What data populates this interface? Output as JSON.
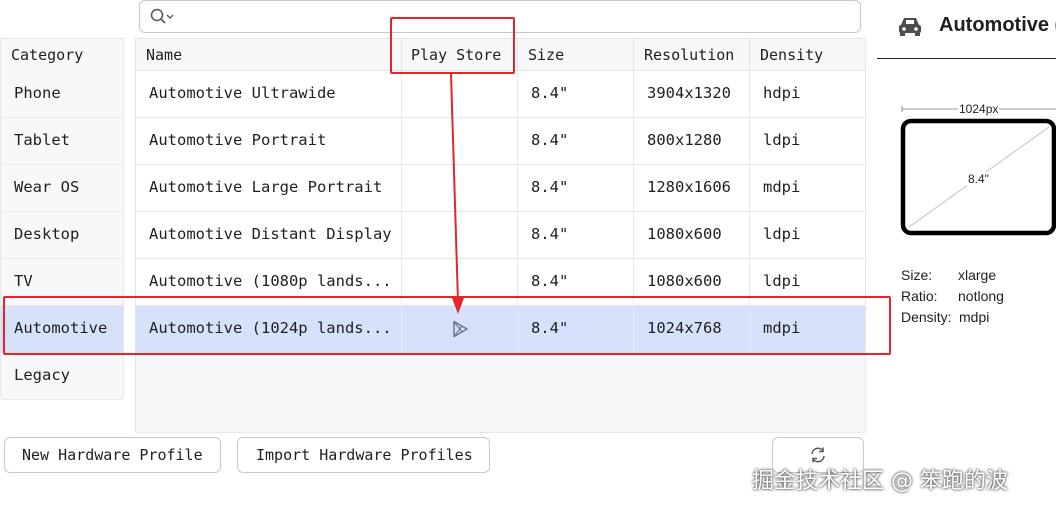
{
  "search": {
    "placeholder": ""
  },
  "category": {
    "header": "Category",
    "items": [
      "Phone",
      "Tablet",
      "Wear OS",
      "Desktop",
      "TV",
      "Automotive",
      "Legacy"
    ],
    "selected": "Automotive"
  },
  "table": {
    "headers": {
      "name": "Name",
      "play_store": "Play Store",
      "size": "Size",
      "resolution": "Resolution",
      "density": "Density"
    },
    "rows": [
      {
        "name": "Automotive Ultrawide",
        "size": "8.4\"",
        "resolution": "3904x1320",
        "density": "hdpi",
        "play_store": false
      },
      {
        "name": "Automotive Portrait",
        "size": "8.4\"",
        "resolution": "800x1280",
        "density": "ldpi",
        "play_store": false
      },
      {
        "name": "Automotive Large Portrait",
        "size": "8.4\"",
        "resolution": "1280x1606",
        "density": "mdpi",
        "play_store": false
      },
      {
        "name": "Automotive Distant Display",
        "size": "8.4\"",
        "resolution": "1080x600",
        "density": "ldpi",
        "play_store": false
      },
      {
        "name": "Automotive (1080p lands...",
        "size": "8.4\"",
        "resolution": "1080x600",
        "density": "ldpi",
        "play_store": false
      },
      {
        "name": "Automotive (1024p lands...",
        "size": "8.4\"",
        "resolution": "1024x768",
        "density": "mdpi",
        "play_store": true,
        "selected": true
      }
    ]
  },
  "buttons": {
    "new_profile": "New Hardware Profile",
    "import_profiles": "Import Hardware Profiles"
  },
  "preview": {
    "title": "Automotive (",
    "width_label": "1024px",
    "diagonal_label": "8.4\"",
    "size_label": "Size:",
    "size_value": "xlarge",
    "ratio_label": "Ratio:",
    "ratio_value": "notlong",
    "density_label": "Density:",
    "density_value": "mdpi"
  },
  "watermark": "掘金技术社区 @ 笨跑的波",
  "colors": {
    "accent_selected": "#d6e2fb",
    "annotation_red": "#e3262b"
  }
}
